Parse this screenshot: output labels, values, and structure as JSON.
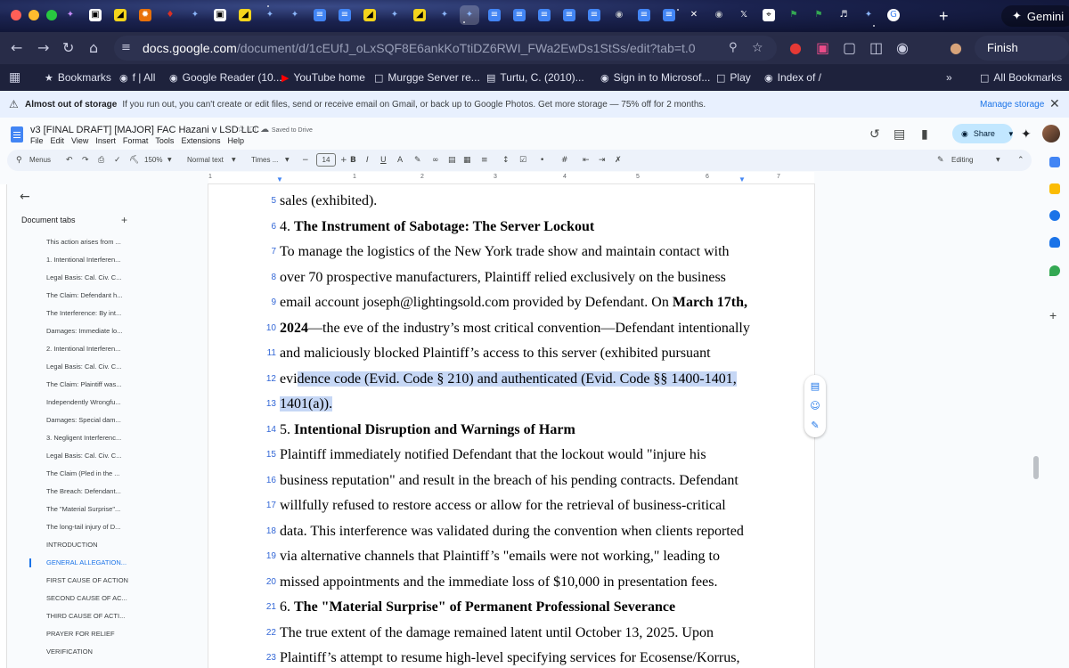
{
  "browser": {
    "address_url_host": "docs.google.com",
    "address_url_path": "/document/d/1cEUfJ_oLxSQF8E6ankKoTtiDZ6RWI_FWa2EwDs1StSs/edit?tab=t.0",
    "gemini_label": "Gemini",
    "finish_update_label": "Finish update"
  },
  "bookmarks": [
    {
      "icon": "star-icon",
      "label": "Bookmarks"
    },
    {
      "icon": "globe-icon",
      "label": "f | All"
    },
    {
      "icon": "globe-icon",
      "label": "Google Reader (10..."
    },
    {
      "icon": "youtube-icon",
      "label": "YouTube home"
    },
    {
      "icon": "folder-icon",
      "label": "Murgge Server re..."
    },
    {
      "icon": "page-icon",
      "label": "Turtu, C. (2010)..."
    },
    {
      "icon": "globe-icon",
      "label": "Sign in to Microsof..."
    },
    {
      "icon": "folder-icon",
      "label": "Play"
    },
    {
      "icon": "globe-icon",
      "label": "Index of /"
    },
    {
      "icon": "folder-icon",
      "label": "All Bookmarks"
    }
  ],
  "storage_banner": {
    "title": "Almost out of storage",
    "message": "If you run out, you can't create or edit files, send or receive email on Gmail, or back up to Google Photos. Get more storage — 75% off for 2 months.",
    "action": "Manage storage"
  },
  "docs": {
    "title": "v3 [FINAL DRAFT] [MAJOR] FAC Hazani v LSD LLC",
    "saved_status": "Saved to Drive",
    "menus": [
      "File",
      "Edit",
      "View",
      "Insert",
      "Format",
      "Tools",
      "Extensions",
      "Help"
    ],
    "share_label": "Share"
  },
  "toolbar": {
    "menus_label": "Menus",
    "zoom": "150%",
    "style": "Normal text",
    "font": "Times ...",
    "font_size": "14",
    "mode": "Editing"
  },
  "ruler_numbers": [
    "1",
    "1",
    "2",
    "3",
    "4",
    "5",
    "6",
    "7"
  ],
  "outline": {
    "label": "Document tabs",
    "active_index": 19,
    "items": [
      "This action arises from ...",
      "1. Intentional Interferen...",
      "Legal Basis: Cal. Civ. C...",
      "The Claim: Defendant h...",
      "The Interference: By int...",
      "Damages: Immediate lo...",
      "2. Intentional Interferen...",
      "Legal Basis: Cal. Civ. C...",
      "The Claim: Plaintiff was...",
      "Independently Wrongfu...",
      "Damages: Special dam...",
      "3. Negligent Interferenc...",
      "Legal Basis: Cal. Civ. C...",
      "The Claim (Pled in the ...",
      "The Breach: Defendant...",
      "The \"Material Surprise\"...",
      "The long-tail injury of D...",
      "INTRODUCTION",
      "GENERAL ALLEGATION...",
      "FIRST CAUSE OF ACTION",
      "SECOND CAUSE OF AC...",
      "THIRD CAUSE OF ACTI...",
      "PRAYER FOR RELIEF",
      "VERIFICATION"
    ]
  },
  "document": {
    "lines": [
      {
        "n": "5",
        "segments": [
          {
            "t": "sales (exhibited).",
            "b": false
          }
        ]
      },
      {
        "n": "6",
        "segments": [
          {
            "t": "4. ",
            "b": false
          },
          {
            "t": "The Instrument of Sabotage: The Server Lockout",
            "b": true
          }
        ]
      },
      {
        "n": "7",
        "segments": [
          {
            "t": "To manage the logistics of the New York trade show and maintain contact with",
            "b": false
          }
        ]
      },
      {
        "n": "8",
        "segments": [
          {
            "t": "over 70 prospective manufacturers, Plaintiff relied exclusively on the business",
            "b": false
          }
        ]
      },
      {
        "n": "9",
        "segments": [
          {
            "t": "email account joseph@lightingsold.com provided by Defendant. On ",
            "b": false
          },
          {
            "t": "March 17th,",
            "b": true
          }
        ]
      },
      {
        "n": "10",
        "segments": [
          {
            "t": "2024",
            "b": true
          },
          {
            "t": "—the eve of the industry’s most critical convention—Defendant intentionally",
            "b": false
          }
        ]
      },
      {
        "n": "11",
        "segments": [
          {
            "t": "and maliciously blocked Plaintiff’s access to this server (exhibited pursuant",
            "b": false
          }
        ]
      },
      {
        "n": "12",
        "segments": [
          {
            "t": "evi",
            "b": false
          },
          {
            "t": "dence code (Evid. Code § 210) and authenticated (Evid. Code §§ 1400-1401,",
            "b": false,
            "sel": true
          }
        ]
      },
      {
        "n": "13",
        "segments": [
          {
            "t": "1401(a)).",
            "b": false,
            "sel": true
          }
        ]
      },
      {
        "n": "14",
        "segments": [
          {
            "t": "5. ",
            "b": false
          },
          {
            "t": "Intentional Disruption and Warnings of Harm",
            "b": true
          }
        ]
      },
      {
        "n": "15",
        "segments": [
          {
            "t": "Plaintiff immediately notified Defendant that the lockout would \"injure his",
            "b": false
          }
        ]
      },
      {
        "n": "16",
        "segments": [
          {
            "t": "business reputation\" and result in the breach of his pending contracts. Defendant",
            "b": false
          }
        ]
      },
      {
        "n": "17",
        "segments": [
          {
            "t": "willfully refused to restore access or allow for the retrieval of business-critical",
            "b": false
          }
        ]
      },
      {
        "n": "18",
        "segments": [
          {
            "t": "data. This interference was validated during the convention when clients reported",
            "b": false
          }
        ]
      },
      {
        "n": "19",
        "segments": [
          {
            "t": "via alternative channels that Plaintiff’s \"emails were not working,\" leading to",
            "b": false
          }
        ]
      },
      {
        "n": "20",
        "segments": [
          {
            "t": "missed appointments and the immediate loss of $10,000 in presentation fees.",
            "b": false
          }
        ]
      },
      {
        "n": "21",
        "segments": [
          {
            "t": "6. ",
            "b": false
          },
          {
            "t": "The \"Material Surprise\" of Permanent Professional Severance",
            "b": true
          }
        ]
      },
      {
        "n": "22",
        "segments": [
          {
            "t": "The true extent of the damage remained latent until October 13, 2025. Upon",
            "b": false
          }
        ]
      },
      {
        "n": "23",
        "segments": [
          {
            "t": "Plaintiff’s attempt to resume high-level specifying services for Ecosense/Korrus,",
            "b": false
          }
        ]
      }
    ]
  }
}
